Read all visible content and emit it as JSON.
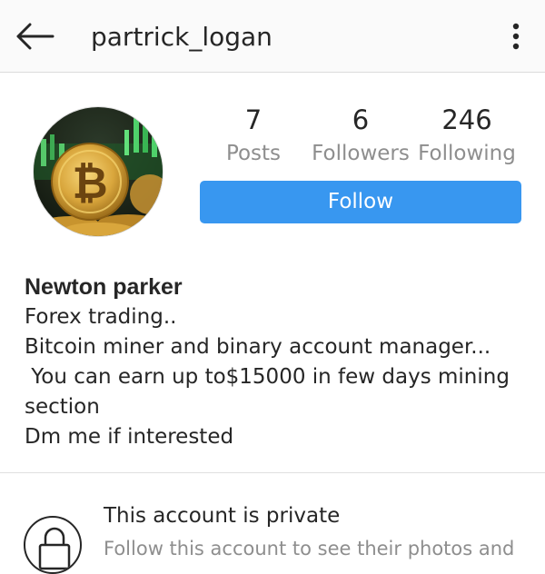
{
  "header": {
    "username": "partrick_logan",
    "back_icon": "arrow-left-icon",
    "more_icon": "more-vertical-icon"
  },
  "profile": {
    "avatar_icon": "bitcoin-coin-image",
    "stats": [
      {
        "value": "7",
        "label": "Posts"
      },
      {
        "value": "6",
        "label": "Followers"
      },
      {
        "value": "246",
        "label": "Following"
      }
    ],
    "follow_label": "Follow",
    "accent_color": "#3897f0"
  },
  "bio": {
    "name": "Newton parker",
    "lines": [
      "Forex trading..",
      "Bitcoin miner and binary account manager...",
      " You can earn up to$15000 in few days mining",
      "section",
      "Dm me if interested"
    ]
  },
  "private_notice": {
    "icon": "lock-icon",
    "title": "This account is private",
    "subtitle": "Follow this account to see their photos and"
  }
}
